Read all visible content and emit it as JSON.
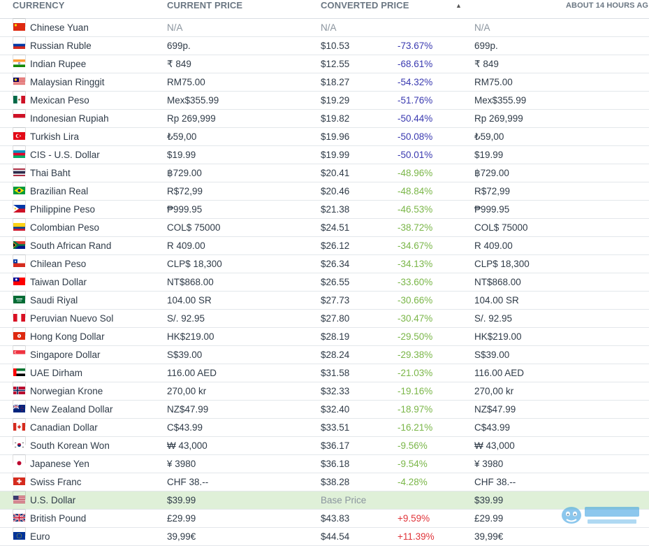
{
  "header": {
    "currency": "CURRENCY",
    "current_price": "CURRENT PRICE",
    "converted_price": "CONVERTED PRICE",
    "sort_indicator": "▲",
    "updated": "ABOUT 14 HOURS AG"
  },
  "rows": [
    {
      "flag": "cn",
      "name": "Chinese Yuan",
      "price": "N/A",
      "converted": "N/A",
      "diff": "",
      "diff_class": "",
      "last": "N/A",
      "na": true
    },
    {
      "flag": "ru",
      "name": "Russian Ruble",
      "price": "699р.",
      "converted": "$10.53",
      "diff": "-73.67%",
      "diff_class": "neg-strong",
      "last": "699р."
    },
    {
      "flag": "in",
      "name": "Indian Rupee",
      "price": "₹ 849",
      "converted": "$12.55",
      "diff": "-68.61%",
      "diff_class": "neg-strong",
      "last": "₹ 849"
    },
    {
      "flag": "my",
      "name": "Malaysian Ringgit",
      "price": "RM75.00",
      "converted": "$18.27",
      "diff": "-54.32%",
      "diff_class": "neg-strong",
      "last": "RM75.00"
    },
    {
      "flag": "mx",
      "name": "Mexican Peso",
      "price": "Mex$355.99",
      "converted": "$19.29",
      "diff": "-51.76%",
      "diff_class": "neg-strong",
      "last": "Mex$355.99"
    },
    {
      "flag": "id",
      "name": "Indonesian Rupiah",
      "price": "Rp 269,999",
      "converted": "$19.82",
      "diff": "-50.44%",
      "diff_class": "neg-strong",
      "last": "Rp 269,999"
    },
    {
      "flag": "tr",
      "name": "Turkish Lira",
      "price": "₺59,00",
      "converted": "$19.96",
      "diff": "-50.08%",
      "diff_class": "neg-strong",
      "last": "₺59,00"
    },
    {
      "flag": "az",
      "name": "CIS - U.S. Dollar",
      "price": "$19.99",
      "converted": "$19.99",
      "diff": "-50.01%",
      "diff_class": "neg-strong",
      "last": "$19.99"
    },
    {
      "flag": "th",
      "name": "Thai Baht",
      "price": "฿729.00",
      "converted": "$20.41",
      "diff": "-48.96%",
      "diff_class": "neg-soft",
      "last": "฿729.00"
    },
    {
      "flag": "br",
      "name": "Brazilian Real",
      "price": "R$72,99",
      "converted": "$20.46",
      "diff": "-48.84%",
      "diff_class": "neg-soft",
      "last": "R$72,99"
    },
    {
      "flag": "ph",
      "name": "Philippine Peso",
      "price": "₱999.95",
      "converted": "$21.38",
      "diff": "-46.53%",
      "diff_class": "neg-soft",
      "last": "₱999.95"
    },
    {
      "flag": "co",
      "name": "Colombian Peso",
      "price": "COL$ 75000",
      "converted": "$24.51",
      "diff": "-38.72%",
      "diff_class": "neg-soft",
      "last": "COL$ 75000"
    },
    {
      "flag": "za",
      "name": "South African Rand",
      "price": "R 409.00",
      "converted": "$26.12",
      "diff": "-34.67%",
      "diff_class": "neg-soft",
      "last": "R 409.00"
    },
    {
      "flag": "cl",
      "name": "Chilean Peso",
      "price": "CLP$ 18,300",
      "converted": "$26.34",
      "diff": "-34.13%",
      "diff_class": "neg-soft",
      "last": "CLP$ 18,300"
    },
    {
      "flag": "tw",
      "name": "Taiwan Dollar",
      "price": "NT$868.00",
      "converted": "$26.55",
      "diff": "-33.60%",
      "diff_class": "neg-soft",
      "last": "NT$868.00"
    },
    {
      "flag": "sa",
      "name": "Saudi Riyal",
      "price": "104.00 SR",
      "converted": "$27.73",
      "diff": "-30.66%",
      "diff_class": "neg-soft",
      "last": "104.00 SR"
    },
    {
      "flag": "pe",
      "name": "Peruvian Nuevo Sol",
      "price": "S/. 92.95",
      "converted": "$27.80",
      "diff": "-30.47%",
      "diff_class": "neg-soft",
      "last": "S/. 92.95"
    },
    {
      "flag": "hk",
      "name": "Hong Kong Dollar",
      "price": "HK$219.00",
      "converted": "$28.19",
      "diff": "-29.50%",
      "diff_class": "neg-soft",
      "last": "HK$219.00"
    },
    {
      "flag": "sg",
      "name": "Singapore Dollar",
      "price": "S$39.00",
      "converted": "$28.24",
      "diff": "-29.38%",
      "diff_class": "neg-soft",
      "last": "S$39.00"
    },
    {
      "flag": "ae",
      "name": "UAE Dirham",
      "price": "116.00 AED",
      "converted": "$31.58",
      "diff": "-21.03%",
      "diff_class": "neg-soft",
      "last": "116.00 AED"
    },
    {
      "flag": "no",
      "name": "Norwegian Krone",
      "price": "270,00 kr",
      "converted": "$32.33",
      "diff": "-19.16%",
      "diff_class": "neg-soft",
      "last": "270,00 kr"
    },
    {
      "flag": "nz",
      "name": "New Zealand Dollar",
      "price": "NZ$47.99",
      "converted": "$32.40",
      "diff": "-18.97%",
      "diff_class": "neg-soft",
      "last": "NZ$47.99"
    },
    {
      "flag": "ca",
      "name": "Canadian Dollar",
      "price": "C$43.99",
      "converted": "$33.51",
      "diff": "-16.21%",
      "diff_class": "neg-soft",
      "last": "C$43.99"
    },
    {
      "flag": "kr",
      "name": "South Korean Won",
      "price": "₩ 43,000",
      "converted": "$36.17",
      "diff": "-9.56%",
      "diff_class": "neg-soft",
      "last": "₩ 43,000"
    },
    {
      "flag": "jp",
      "name": "Japanese Yen",
      "price": "¥ 3980",
      "converted": "$36.18",
      "diff": "-9.54%",
      "diff_class": "neg-soft",
      "last": "¥ 3980"
    },
    {
      "flag": "ch",
      "name": "Swiss Franc",
      "price": "CHF 38.--",
      "converted": "$38.28",
      "diff": "-4.28%",
      "diff_class": "neg-soft",
      "last": "CHF 38.--"
    },
    {
      "flag": "us",
      "name": "U.S. Dollar",
      "price": "$39.99",
      "converted": "Base Price",
      "diff": "",
      "diff_class": "",
      "last": "$39.99",
      "base": true
    },
    {
      "flag": "gb",
      "name": "British Pound",
      "price": "£29.99",
      "converted": "$43.83",
      "diff": "+9.59%",
      "diff_class": "pos",
      "last": "£29.99"
    },
    {
      "flag": "eu",
      "name": "Euro",
      "price": "39,99€",
      "converted": "$44.54",
      "diff": "+11.39%",
      "diff_class": "pos",
      "last": "39,99€"
    }
  ],
  "colors": {
    "header_text": "#6b7783",
    "text": "#2f3b48",
    "na": "#8a949e",
    "neg_strong": "#3a3ab0",
    "neg_soft": "#7ab648",
    "pos": "#e0343a",
    "base_row_bg": "#dff0d8"
  }
}
